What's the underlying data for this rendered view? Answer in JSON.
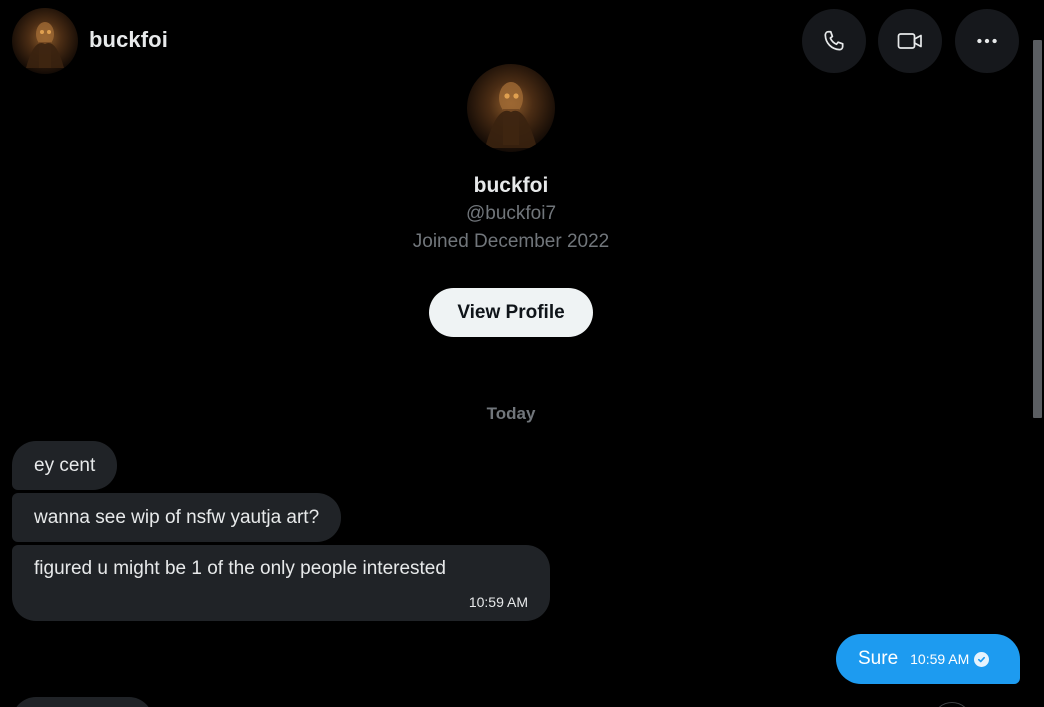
{
  "header": {
    "name": "buckfoi",
    "avatar_icon": "user-avatar",
    "actions": [
      {
        "name": "call",
        "icon": "phone-icon"
      },
      {
        "name": "video",
        "icon": "video-icon"
      },
      {
        "name": "more",
        "icon": "more-horizontal-icon"
      }
    ]
  },
  "profile": {
    "display_name": "buckfoi",
    "handle": "@buckfoi7",
    "joined": "Joined December 2022",
    "view_profile_label": "View Profile"
  },
  "conversation": {
    "date_label": "Today",
    "messages": [
      {
        "direction": "received",
        "text": "ey cent",
        "time": ""
      },
      {
        "direction": "received",
        "text": "wanna see wip of nsfw yautja art?",
        "time": ""
      },
      {
        "direction": "received",
        "text": "figured u might be 1 of the only people interested",
        "time": "10:59 AM"
      },
      {
        "direction": "sent",
        "text": "Sure",
        "time": "10:59 AM",
        "status": "read"
      }
    ]
  },
  "colors": {
    "background": "#000000",
    "received_bubble": "#202327",
    "sent_bubble": "#1d9bf0",
    "muted_text": "#71767b",
    "primary_text": "#e7e9ea",
    "button_bg": "#16181c"
  }
}
